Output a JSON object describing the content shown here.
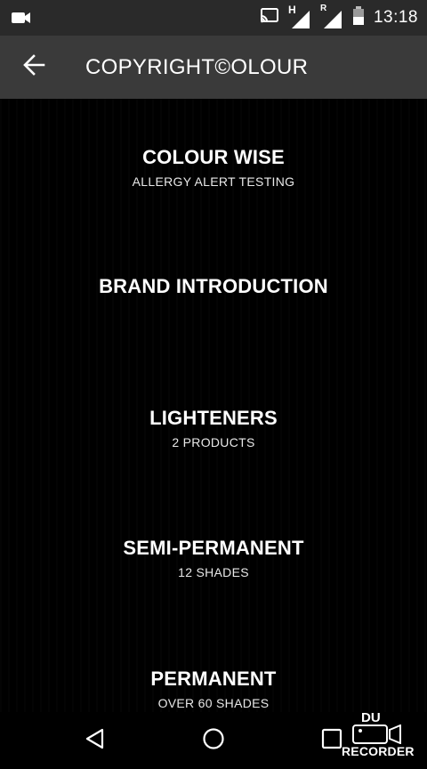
{
  "status_bar": {
    "time": "13:18",
    "network_type": "H",
    "roaming": "R",
    "icons": [
      "video-camera-icon",
      "cast-icon",
      "signal-icon",
      "signal-roaming-icon",
      "battery-icon"
    ]
  },
  "app_bar": {
    "title": "COPYRIGHT©OLOUR",
    "back_icon": "arrow-left-icon"
  },
  "menu": [
    {
      "title": "COLOUR WISE",
      "subtitle": "ALLERGY ALERT TESTING"
    },
    {
      "title": "BRAND INTRODUCTION",
      "subtitle": ""
    },
    {
      "title": "LIGHTENERS",
      "subtitle": "2 PRODUCTS"
    },
    {
      "title": "SEMI-PERMANENT",
      "subtitle": "12 SHADES"
    },
    {
      "title": "PERMANENT",
      "subtitle": "OVER 60 SHADES"
    }
  ],
  "nav_bar": {
    "icons": [
      "back-triangle-icon",
      "home-circle-icon",
      "recents-square-icon"
    ]
  },
  "watermark": {
    "line1": "DU",
    "line2": "RECORDER"
  },
  "colors": {
    "status_bar_bg": "#2a2a2a",
    "app_bar_bg": "#3a3a3a",
    "content_bg": "#000000",
    "text": "#ffffff"
  }
}
